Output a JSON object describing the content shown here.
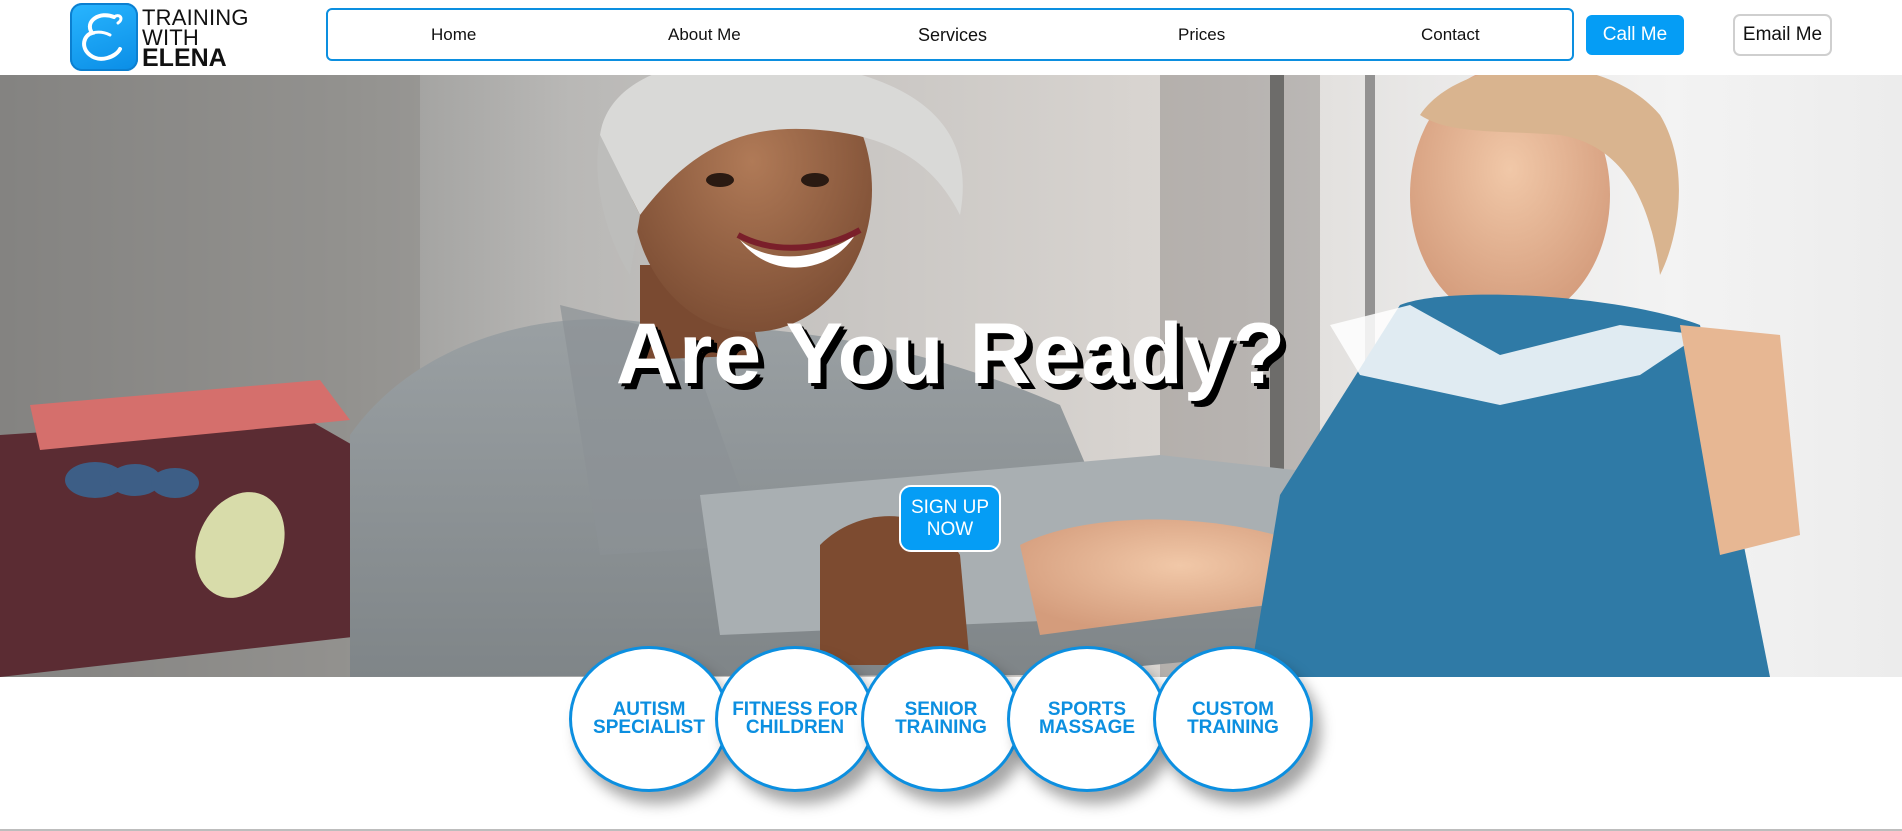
{
  "brand": {
    "line1": "TRAINING",
    "line2": "WITH",
    "line3": "ELENA",
    "mark_letter": "E",
    "accent_color": "#059df5"
  },
  "nav": {
    "items": [
      {
        "label": "Home"
      },
      {
        "label": "About Me"
      },
      {
        "label": "Services"
      },
      {
        "label": "Prices"
      },
      {
        "label": "Contact"
      }
    ]
  },
  "actions": {
    "call_label": "Call Me",
    "email_label": "Email Me"
  },
  "hero": {
    "title": "Are You Ready?",
    "signup_line1": "SIGN UP",
    "signup_line2": "NOW"
  },
  "services": [
    {
      "line1": "AUTISM",
      "line2": "SPECIALIST"
    },
    {
      "line1": "FITNESS FOR",
      "line2": "CHILDREN"
    },
    {
      "line1": "SENIOR",
      "line2": "TRAINING"
    },
    {
      "line1": "SPORTS",
      "line2": "MASSAGE"
    },
    {
      "line1": "CUSTOM",
      "line2": "TRAINING"
    }
  ]
}
